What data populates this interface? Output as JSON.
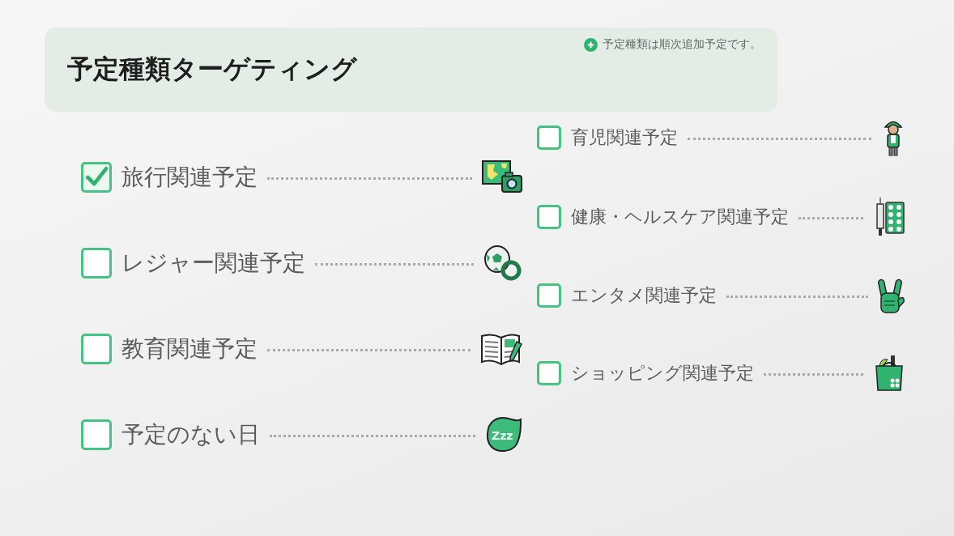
{
  "header": {
    "title": "予定種類ターゲティング",
    "note": "予定種類は順次追加予定です。"
  },
  "columns": [
    {
      "items": [
        {
          "label": "旅行関連予定",
          "checked": true,
          "kind": "travel"
        },
        {
          "label": "レジャー関連予定",
          "checked": false,
          "kind": "leisure"
        },
        {
          "label": "教育関連予定",
          "checked": false,
          "kind": "education"
        },
        {
          "label": "予定のない日",
          "checked": false,
          "kind": "rest",
          "icon_text": "Zzz"
        }
      ]
    },
    {
      "items": [
        {
          "label": "育児関連予定",
          "checked": false,
          "kind": "childcare"
        },
        {
          "label": "健康・ヘルスケア関連予定",
          "checked": false,
          "kind": "health"
        },
        {
          "label": "エンタメ関連予定",
          "checked": false,
          "kind": "entertainment"
        },
        {
          "label": "ショッピング関連予定",
          "checked": false,
          "kind": "shopping"
        }
      ]
    }
  ]
}
